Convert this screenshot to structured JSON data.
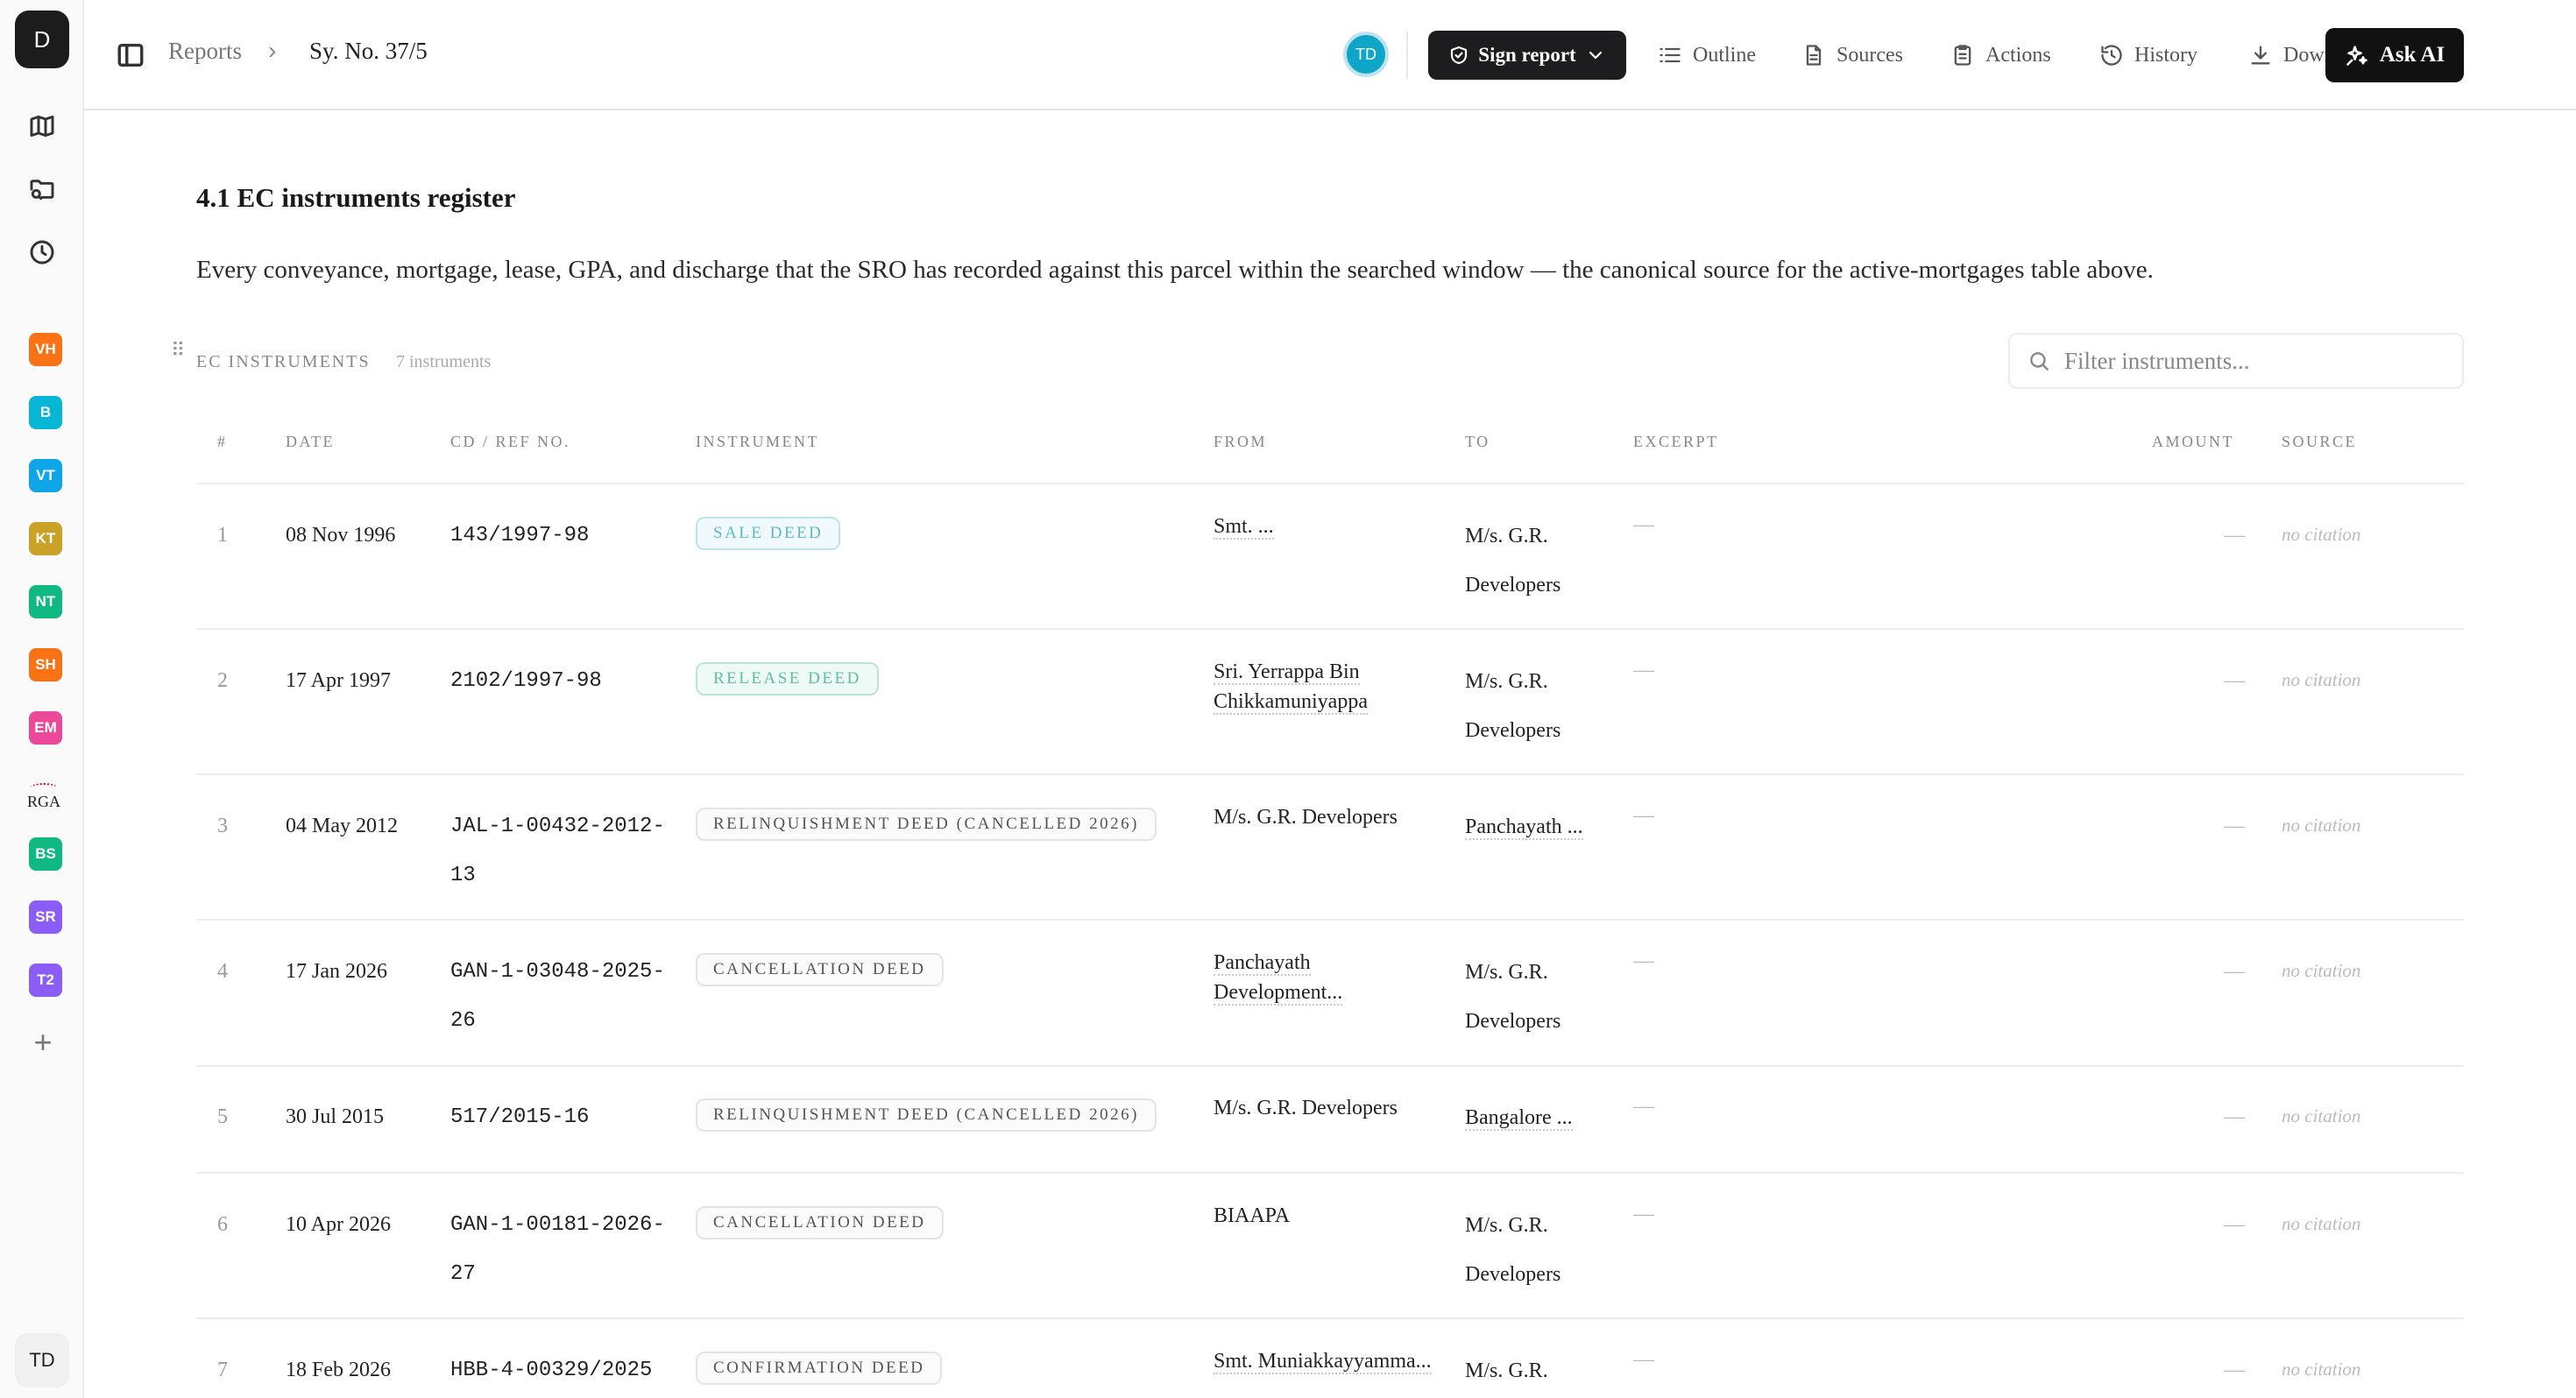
{
  "rail": {
    "workspace_initial": "D",
    "projects": [
      {
        "label": "VH",
        "color": "#f97316"
      },
      {
        "label": "B",
        "color": "#06b6d4"
      },
      {
        "label": "VT",
        "color": "#0ea5e9"
      },
      {
        "label": "KT",
        "color": "#c9a227"
      },
      {
        "label": "NT",
        "color": "#10b981"
      },
      {
        "label": "SH",
        "color": "#f97316"
      },
      {
        "label": "EM",
        "color": "#ec4899"
      },
      {
        "label": "RGA",
        "color": "logo"
      },
      {
        "label": "BS",
        "color": "#10b981"
      },
      {
        "label": "SR",
        "color": "#8b5cf6"
      },
      {
        "label": "T2",
        "color": "#8b5cf6"
      }
    ],
    "add_label": "+",
    "user_initials": "TD"
  },
  "topbar": {
    "breadcrumb_root": "Reports",
    "breadcrumb_sep": "›",
    "breadcrumb_current": "Sy. No. 37/5",
    "avatar_initials": "TD",
    "sign_label": "Sign report",
    "actions": [
      "Outline",
      "Sources",
      "Actions",
      "History",
      "Download"
    ],
    "ask_label": "Ask AI"
  },
  "section": {
    "title": "4.1 EC instruments register",
    "description": "Every conveyance, mortgage, lease, GPA, and discharge that the SRO has recorded against this parcel within the searched window — the canonical source for the active-mortgages table above."
  },
  "table": {
    "label": "EC INSTRUMENTS",
    "count": "7 instruments",
    "filter_placeholder": "Filter instruments...",
    "headers": [
      "#",
      "DATE",
      "CD / REF NO.",
      "INSTRUMENT",
      "FROM",
      "TO",
      "EXCERPT",
      "AMOUNT",
      "SOURCE"
    ],
    "rows": [
      {
        "num": "1",
        "date": "08 Nov 1996",
        "ref": "143/1997-98",
        "instrument": "SALE DEED",
        "from": "Smt. ...",
        "to": "M/s. G.R. Developers",
        "excerpt": "—",
        "amount": "—",
        "source": "no citation"
      },
      {
        "num": "2",
        "date": "17 Apr 1997",
        "ref": "2102/1997-98",
        "instrument": "RELEASE DEED",
        "from": "Sri. Yerrappa Bin Chikkamuniyappa",
        "to": "M/s. G.R. Developers",
        "excerpt": "—",
        "amount": "—",
        "source": "no citation"
      },
      {
        "num": "3",
        "date": "04 May 2012",
        "ref": "JAL-1-00432-2012-13",
        "instrument": "RELINQUISHMENT DEED (CANCELLED 2026)",
        "from": "M/s. G.R. Developers",
        "to": "Panchayath ...",
        "excerpt": "—",
        "amount": "—",
        "source": "no citation"
      },
      {
        "num": "4",
        "date": "17 Jan 2026",
        "ref": "GAN-1-03048-2025-26",
        "instrument": "CANCELLATION DEED",
        "from": "Panchayath Development...",
        "to": "M/s. G.R. Developers",
        "excerpt": "—",
        "amount": "—",
        "source": "no citation"
      },
      {
        "num": "5",
        "date": "30 Jul 2015",
        "ref": "517/2015-16",
        "instrument": "RELINQUISHMENT DEED (CANCELLED 2026)",
        "from": "M/s. G.R. Developers",
        "to": "Bangalore ...",
        "excerpt": "—",
        "amount": "—",
        "source": "no citation"
      },
      {
        "num": "6",
        "date": "10 Apr 2026",
        "ref": "GAN-1-00181-2026-27",
        "instrument": "CANCELLATION DEED",
        "from": "BIAAPA",
        "to": "M/s. G.R. Developers",
        "excerpt": "—",
        "amount": "—",
        "source": "no citation"
      },
      {
        "num": "7",
        "date": "18 Feb 2026",
        "ref": "HBB-4-00329/2025",
        "instrument": "CONFIRMATION DEED",
        "from": "Smt. Muniakkayyamma...",
        "to": "M/s. G.R.",
        "excerpt": "—",
        "amount": "—",
        "source": "no citation"
      }
    ]
  }
}
